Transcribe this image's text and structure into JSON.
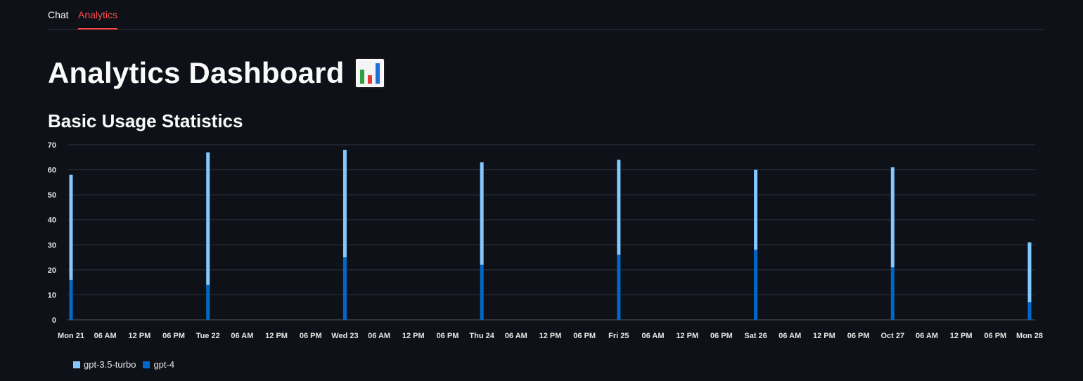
{
  "tabs": [
    {
      "label": "Chat",
      "active": false
    },
    {
      "label": "Analytics",
      "active": true
    }
  ],
  "page": {
    "title": "Analytics Dashboard",
    "title_icon": "bar-chart-emoji-icon",
    "section_title": "Basic Usage Statistics"
  },
  "colors": {
    "background": "#0e1117",
    "accent": "#ff4b4b",
    "gpt35": "#83c9ff",
    "gpt4": "#0068c9",
    "grid": "#31333f"
  },
  "chart_data": {
    "type": "bar",
    "stacked": true,
    "ylim": [
      0,
      70
    ],
    "yticks": [
      0,
      10,
      20,
      30,
      40,
      50,
      60,
      70
    ],
    "xticks": [
      "Mon 21",
      "06 AM",
      "12 PM",
      "06 PM",
      "Tue 22",
      "06 AM",
      "12 PM",
      "06 PM",
      "Wed 23",
      "06 AM",
      "12 PM",
      "06 PM",
      "Thu 24",
      "06 AM",
      "12 PM",
      "06 PM",
      "Fri 25",
      "06 AM",
      "12 PM",
      "06 PM",
      "Sat 26",
      "06 AM",
      "12 PM",
      "06 PM",
      "Oct 27",
      "06 AM",
      "12 PM",
      "06 PM",
      "Mon 28"
    ],
    "categories": [
      "Mon 21",
      "Tue 22",
      "Wed 23",
      "Thu 24",
      "Fri 25",
      "Sat 26",
      "Oct 27",
      "Mon 28"
    ],
    "series": [
      {
        "name": "gpt-4",
        "color": "#0068c9",
        "values": [
          16,
          14,
          25,
          22,
          26,
          28,
          21,
          7
        ]
      },
      {
        "name": "gpt-3.5-turbo",
        "color": "#83c9ff",
        "values": [
          42,
          53,
          43,
          41,
          38,
          32,
          40,
          24
        ]
      }
    ],
    "legend": [
      "gpt-3.5-turbo",
      "gpt-4"
    ],
    "legend_position": "bottom-left",
    "grid": true,
    "xlabel": "",
    "ylabel": ""
  }
}
